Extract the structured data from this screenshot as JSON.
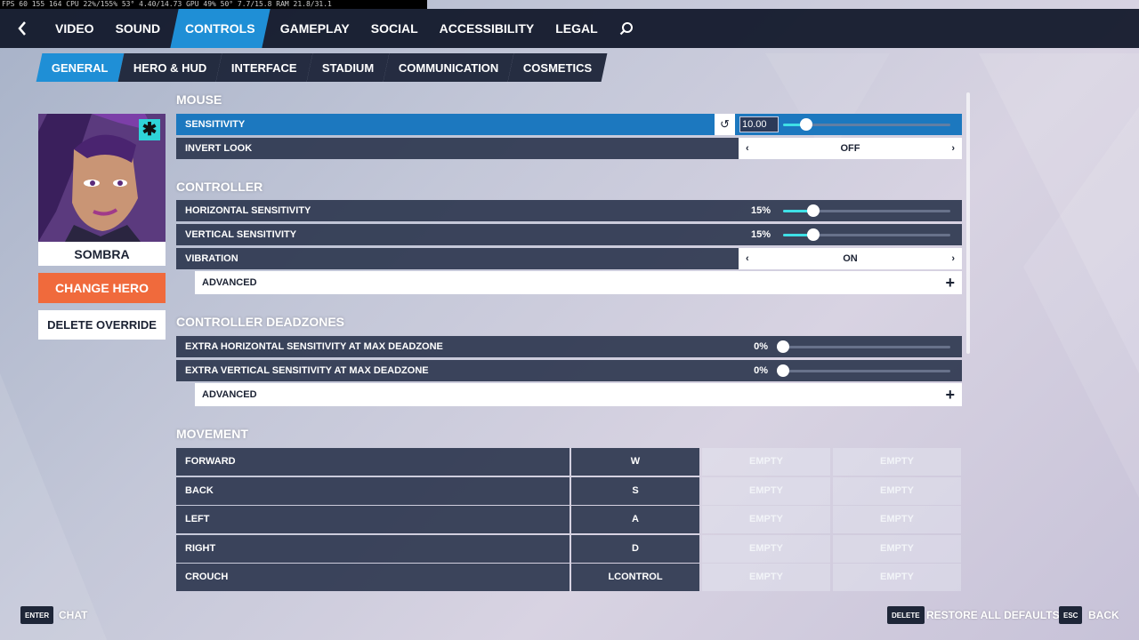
{
  "perf_overlay": "FPS 60  155 164   CPU 22%/155%  53°  4.40/14.73   GPU 49%  50°  7.7/15.8   RAM 21.8/31.1",
  "nav": {
    "tabs": [
      "VIDEO",
      "SOUND",
      "CONTROLS",
      "GAMEPLAY",
      "SOCIAL",
      "ACCESSIBILITY",
      "LEGAL"
    ],
    "active": "CONTROLS"
  },
  "subnav": {
    "tabs": [
      "GENERAL",
      "HERO & HUD",
      "INTERFACE",
      "STADIUM",
      "COMMUNICATION",
      "COSMETICS"
    ],
    "active": "GENERAL"
  },
  "hero": {
    "name": "SOMBRA",
    "change_label": "CHANGE HERO",
    "delete_label": "DELETE OVERRIDE"
  },
  "sections": {
    "mouse": "MOUSE",
    "controller": "CONTROLLER",
    "deadzones": "CONTROLLER DEADZONES",
    "movement": "MOVEMENT"
  },
  "mouse": {
    "sensitivity": {
      "label": "SENSITIVITY",
      "value": "10.00",
      "fraction": 0.14
    },
    "invert_look": {
      "label": "INVERT LOOK",
      "value": "OFF"
    }
  },
  "controller": {
    "horizontal": {
      "label": "HORIZONTAL SENSITIVITY",
      "value": "15%",
      "fraction": 0.18
    },
    "vertical": {
      "label": "VERTICAL SENSITIVITY",
      "value": "15%",
      "fraction": 0.18
    },
    "vibration": {
      "label": "VIBRATION",
      "value": "ON"
    },
    "advanced_label": "ADVANCED"
  },
  "deadzones": {
    "horizontal": {
      "label": "EXTRA HORIZONTAL SENSITIVITY AT MAX DEADZONE",
      "value": "0%",
      "fraction": 0
    },
    "vertical": {
      "label": "EXTRA VERTICAL SENSITIVITY AT MAX DEADZONE",
      "value": "0%",
      "fraction": 0
    },
    "advanced_label": "ADVANCED"
  },
  "movement": [
    {
      "action": "FORWARD",
      "key1": "W",
      "key2": "EMPTY",
      "key3": "EMPTY"
    },
    {
      "action": "BACK",
      "key1": "S",
      "key2": "EMPTY",
      "key3": "EMPTY"
    },
    {
      "action": "LEFT",
      "key1": "A",
      "key2": "EMPTY",
      "key3": "EMPTY"
    },
    {
      "action": "RIGHT",
      "key1": "D",
      "key2": "EMPTY",
      "key3": "EMPTY"
    },
    {
      "action": "CROUCH",
      "key1": "LCONTROL",
      "key2": "EMPTY",
      "key3": "EMPTY"
    }
  ],
  "footer": {
    "chat_key": "ENTER",
    "chat_label": "CHAT",
    "restore_key": "DELETE",
    "restore_label": "RESTORE ALL DEFAULTS",
    "back_key": "ESC",
    "back_label": "BACK"
  },
  "colors": {
    "accent": "#1f8fd6",
    "slider_fill": "#3fe0e6",
    "change_hero": "#f06a3c",
    "hero_badge": "#2fd3d8"
  },
  "icons": {
    "back": "chevron-left-icon",
    "search": "search-icon",
    "reset": "undo-icon",
    "toggle_left": "chevron-left-icon",
    "toggle_right": "chevron-right-icon",
    "expand": "plus-icon",
    "hero_badge": "asterisk-icon"
  }
}
